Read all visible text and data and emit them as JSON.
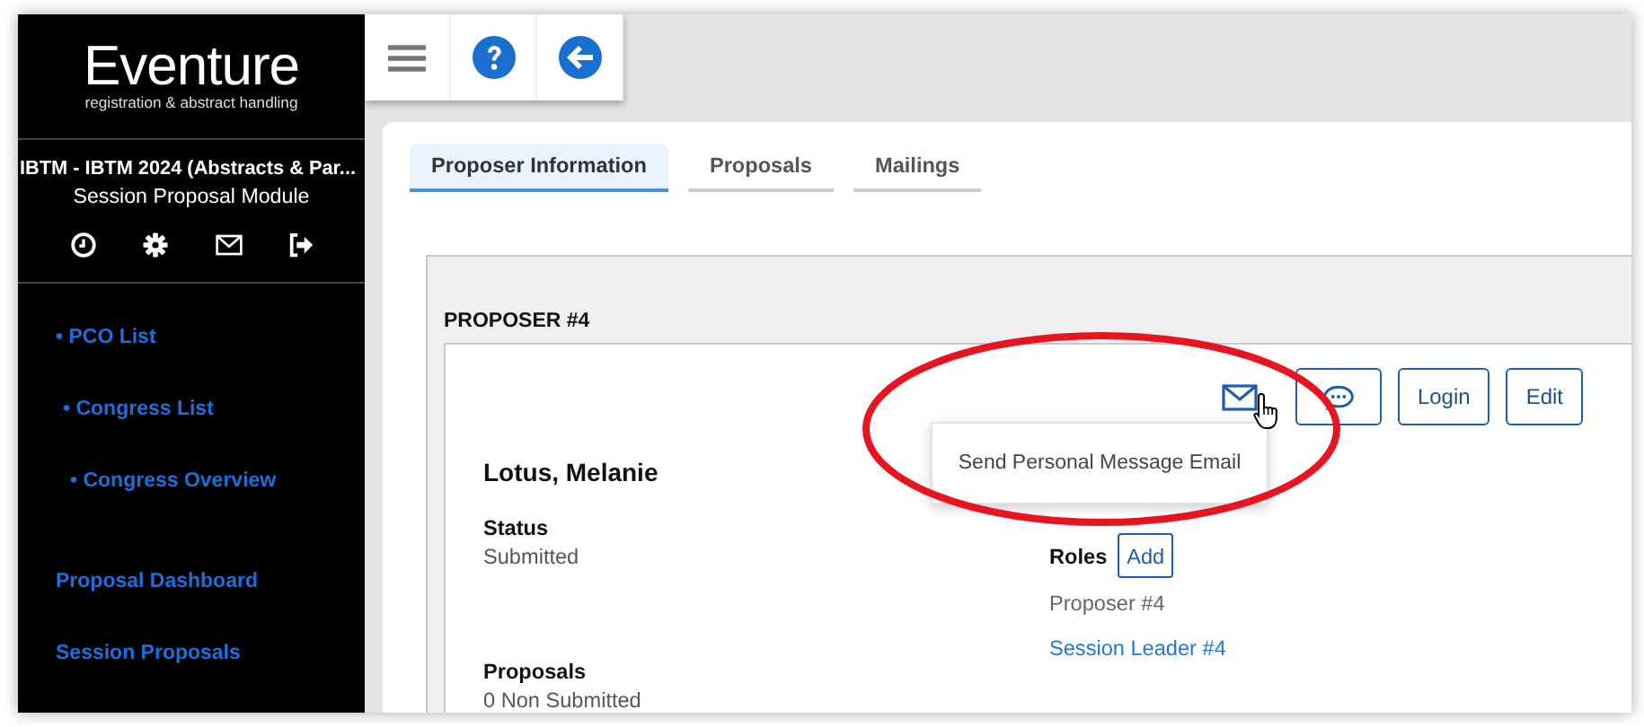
{
  "app": {
    "logo": "Eventure",
    "tagline": "registration & abstract handling",
    "congress": "IBTM - IBTM 2024 (Abstracts & Par...",
    "module": "Session Proposal Module"
  },
  "sidebar": {
    "items": [
      {
        "label": "• PCO List",
        "children": [
          {
            "label": "• Congress List",
            "children": [
              {
                "label": "• Congress Overview"
              }
            ]
          }
        ]
      },
      {
        "label": "Proposal Dashboard"
      },
      {
        "label": "Session Proposals"
      }
    ]
  },
  "tabs": [
    {
      "label": "Proposer Information",
      "selected": true
    },
    {
      "label": "Proposals",
      "selected": false
    },
    {
      "label": "Mailings",
      "selected": false
    }
  ],
  "proposer": {
    "heading": "PROPOSER #4",
    "name": "Lotus, Melanie",
    "buttons": [
      "Login",
      "Edit"
    ],
    "tooltip": "Send Personal Message Email",
    "fields": [
      {
        "label": "Status",
        "value": "Submitted"
      },
      {
        "label": "Proposals",
        "value": "0 Non Submitted"
      }
    ],
    "roles": {
      "label": "Roles",
      "add": "Add",
      "items": [
        {
          "label": "Proposer #4",
          "kind": "text"
        },
        {
          "label": "Session Leader #4",
          "kind": "link"
        }
      ]
    }
  }
}
